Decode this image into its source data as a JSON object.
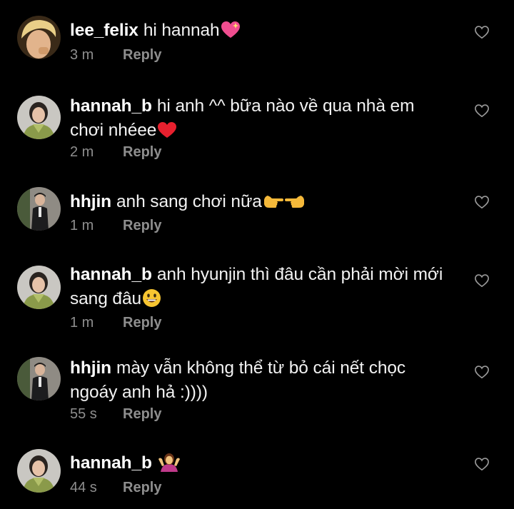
{
  "colors": {
    "background": "#000000",
    "username": "#ffffff",
    "text": "#f2f2f2",
    "meta": "#8e8e8e"
  },
  "comments": [
    {
      "username": "lee_felix",
      "text": "hi hannah",
      "emoji": "sparkling-heart",
      "time": "3 m",
      "reply_label": "Reply",
      "avatar": "blond-man-avatar"
    },
    {
      "username": "hannah_b",
      "text": "hi anh ^^ bữa nào về qua nhà em chơi nhéee",
      "emoji": "red-heart",
      "time": "2 m",
      "reply_label": "Reply",
      "avatar": "woman-scarf-avatar"
    },
    {
      "username": "hhjin",
      "text": "anh sang chơi nữa",
      "emoji": "pointing-hands",
      "time": "1 m",
      "reply_label": "Reply",
      "avatar": "man-suit-avatar"
    },
    {
      "username": "hannah_b",
      "text": "anh hyunjin thì đâu cần phải mời mới sang đâu",
      "emoji": "grinning-face",
      "time": "1 m",
      "reply_label": "Reply",
      "avatar": "woman-scarf-avatar"
    },
    {
      "username": "hhjin",
      "text": "mày vẫn không thể từ bỏ cái nết chọc ngoáy anh hả :))))",
      "emoji": "",
      "time": "55 s",
      "reply_label": "Reply",
      "avatar": "man-suit-avatar"
    },
    {
      "username": "hannah_b",
      "text": "",
      "emoji": "person-shrugging",
      "time": "44 s",
      "reply_label": "Reply",
      "avatar": "woman-scarf-avatar"
    }
  ]
}
